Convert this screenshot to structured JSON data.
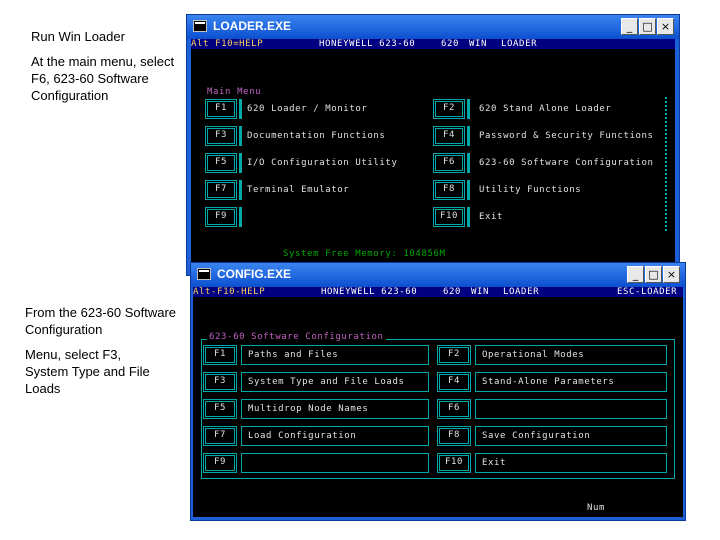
{
  "notes": {
    "run": "Run Win Loader",
    "main_menu": "At the main menu, select F6, 623-60 Software Configuration",
    "from": "From the 623-60 Software Configuration",
    "select": "Menu, select F3, System Type and File Loads"
  },
  "loader_window": {
    "title": "LOADER.EXE",
    "controls": [
      "_",
      "□",
      "×"
    ],
    "header": {
      "left": "Alt F10=HELP",
      "center": "HONEYWELL 623-60",
      "right1": "620",
      "right2": "WIN",
      "right3": "LOADER"
    },
    "menu_title": "Main Menu",
    "items": [
      {
        "key": "F1",
        "label": "620 Loader / Monitor"
      },
      {
        "key": "F2",
        "label": "620 Stand Alone Loader"
      },
      {
        "key": "F3",
        "label": "Documentation Functions"
      },
      {
        "key": "F4",
        "label": "Password & Security Functions"
      },
      {
        "key": "F5",
        "label": "I/O Configuration Utility"
      },
      {
        "key": "F6",
        "label": "623-60 Software Configuration"
      },
      {
        "key": "F7",
        "label": "Terminal Emulator"
      },
      {
        "key": "F8",
        "label": "Utility Functions"
      },
      {
        "key": "F9",
        "label": ""
      },
      {
        "key": "F10",
        "label": "Exit"
      }
    ],
    "status": "System Free Memory: 104856M"
  },
  "config_window": {
    "title": "CONFIG.EXE",
    "controls": [
      "_",
      "□",
      "×"
    ],
    "header": {
      "left": "Alt-F10-HELP",
      "center": "HONEYWELL 623-60",
      "right1": "620",
      "right2": "WIN",
      "right3": "LOADER",
      "far_right": "ESC-LOADER"
    },
    "section_title": "623-60 Software Configuration",
    "items": [
      {
        "key": "F1",
        "label": "Paths and Files"
      },
      {
        "key": "F2",
        "label": "Operational Modes"
      },
      {
        "key": "F3",
        "label": "System Type and File Loads"
      },
      {
        "key": "F4",
        "label": "Stand-Alone Parameters"
      },
      {
        "key": "F5",
        "label": "Multidrop Node Names"
      },
      {
        "key": "F6",
        "label": ""
      },
      {
        "key": "F7",
        "label": "Load Configuration"
      },
      {
        "key": "F8",
        "label": "Save Configuration"
      },
      {
        "key": "F9",
        "label": ""
      },
      {
        "key": "F10",
        "label": "Exit"
      }
    ],
    "status": "Num"
  }
}
